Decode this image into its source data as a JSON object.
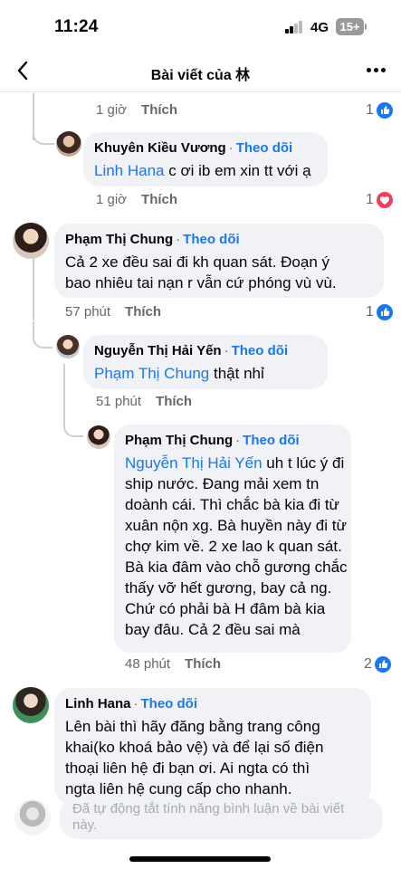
{
  "status_bar": {
    "time": "11:24",
    "network": "4G",
    "battery": "15+"
  },
  "header": {
    "title": "Bài viết của 林"
  },
  "comments": [
    {
      "time": "1 giờ",
      "like_label": "Thích",
      "reaction_count": "1",
      "reaction_type": "like"
    },
    {
      "name": "Khuyên Kiều Vương",
      "dot": "·",
      "follow": "Theo dõi",
      "mention": "Linh Hana",
      "text": " c ơi ib em xin tt với ạ",
      "time": "1 giờ",
      "like_label": "Thích",
      "reaction_count": "1",
      "reaction_type": "love"
    },
    {
      "name": "Phạm Thị Chung",
      "dot": "·",
      "follow": "Theo dõi",
      "lines": [
        "Cả 2 xe đều sai đi kh quan sát. Đoạn ý",
        "bao nhiêu tai nạn r vẫn cứ phóng vù vù."
      ],
      "time": "57 phút",
      "like_label": "Thích",
      "reaction_count": "1",
      "reaction_type": "like"
    },
    {
      "name": "Nguyễn Thị Hải Yến",
      "dot": "·",
      "follow": "Theo dõi",
      "mention": "Phạm Thị Chung",
      "text": " thật nhỉ",
      "time": "51 phút",
      "like_label": "Thích"
    },
    {
      "name": "Phạm Thị Chung",
      "dot": "·",
      "follow": "Theo dõi",
      "mention": "Nguyễn Thị Hải Yến",
      "first_line_rest": " uh t lúc ý đi",
      "lines": [
        "ship nước. Đang mải xem tn",
        "doành cái. Thì chắc bà kia đi từ",
        "xuân nộn xg. Bà huyền này đi từ",
        "chợ kim về. 2 xe lao k quan sát.",
        "Bà kia đâm vào chỗ gương chắc",
        "thấy vỡ hết gương, bay cả ng.",
        "Chứ có phải bà H đâm bà kia",
        "bay đâu. Cả 2 đều sai mà"
      ],
      "time": "48 phút",
      "like_label": "Thích",
      "reaction_count": "2",
      "reaction_type": "like"
    },
    {
      "name": "Linh Hana",
      "dot": "·",
      "follow": "Theo dõi",
      "lines": [
        "Lên bài thì hãy đăng bằng trang công",
        "khai(ko khoá bảo vệ) và để lại số điện",
        "thoại liên hệ đi bạn ơi. Ai ngta có thì",
        "ngta liên hệ cung cấp cho nhanh."
      ]
    }
  ],
  "composer": {
    "placeholder": "Đã tự động tắt tính năng bình luận về bài viết này."
  },
  "colors": {
    "link": "#1877f2",
    "secondary": "#65676b",
    "bubble": "#f0f2f5",
    "like": "#1877f2",
    "love": "#f33e58"
  }
}
